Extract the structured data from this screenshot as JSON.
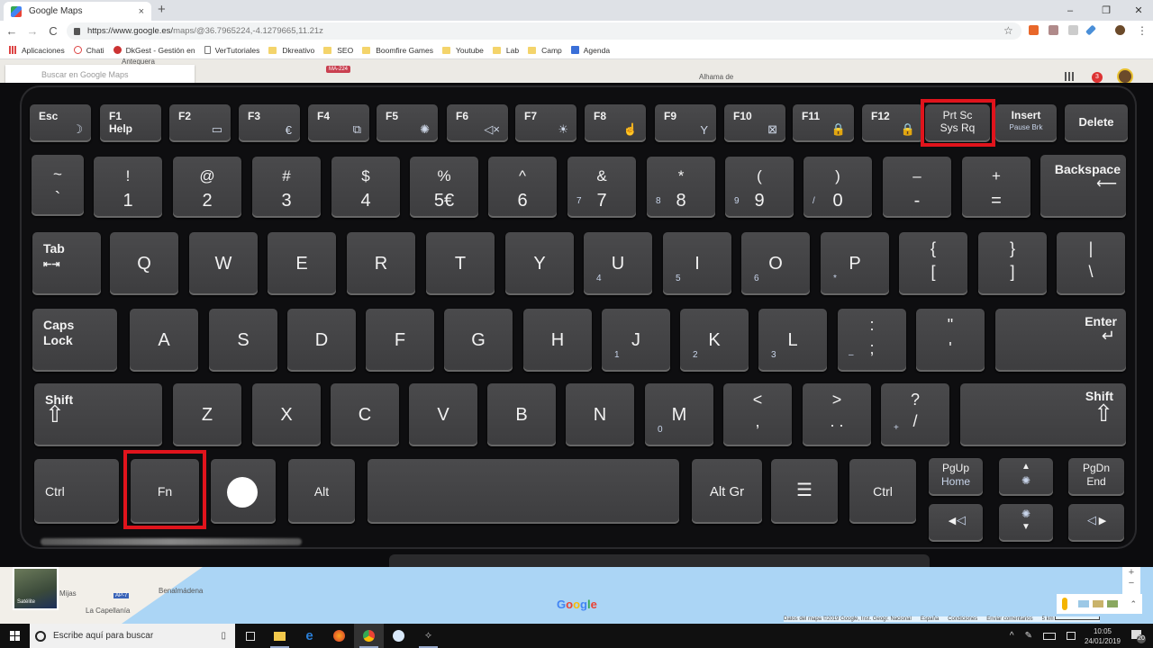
{
  "browser": {
    "tab_title": "Google Maps",
    "tab_close": "×",
    "new_tab": "+",
    "window_controls": {
      "minimize": "–",
      "restore": "❐",
      "close": "✕"
    },
    "nav": {
      "back": "←",
      "forward": "→",
      "reload": "C"
    },
    "url_host": "https://www.google.es/",
    "url_path": "maps/@36.7965224,-4.1279665,11.21z",
    "bookmark_star": "☆",
    "menu": "⋮",
    "bookmarks": [
      {
        "label": "Aplicaciones",
        "icon": "apps-grid-icon"
      },
      {
        "label": "Chati",
        "icon": "chat-icon"
      },
      {
        "label": "DkGest - Gestión en",
        "icon": "dkgest-icon"
      },
      {
        "label": "VerTutoriales",
        "icon": "page-icon"
      },
      {
        "label": "Dkreativo",
        "icon": "folder-icon"
      },
      {
        "label": "SEO",
        "icon": "folder-icon"
      },
      {
        "label": "Boomfire Games",
        "icon": "folder-icon"
      },
      {
        "label": "Youtube",
        "icon": "folder-icon"
      },
      {
        "label": "Lab",
        "icon": "folder-icon"
      },
      {
        "label": "Camp",
        "icon": "folder-icon"
      },
      {
        "label": "Agenda",
        "icon": "calendar-icon"
      }
    ]
  },
  "map": {
    "search_placeholder": "Buscar en Google Maps",
    "road_badge": "MA-224",
    "labels": {
      "top_town": "Antequera",
      "alhama": "Alhama de",
      "mijas": "Mijas",
      "benalmadena": "Benalmádena",
      "capellania": "La Capellanía",
      "ap7": "AP-7"
    },
    "satellite_label": "Satélite",
    "google_logo": "Google",
    "notification_count": "3",
    "footer": [
      "Datos del mapa ©2019 Google, Inst. Geogr. Nacional",
      "España",
      "Condiciones",
      "Enviar comentarios",
      "5 km"
    ],
    "zoom_plus": "+",
    "zoom_minus": "−",
    "expand": "⌃"
  },
  "keyboard": {
    "highlight_color": "#e0141c",
    "fn_row": [
      {
        "label": "Esc",
        "sub": "",
        "icon": "☽"
      },
      {
        "label": "F1",
        "sub": "Help",
        "icon": ""
      },
      {
        "label": "F2",
        "sub": "",
        "icon": "▭"
      },
      {
        "label": "F3",
        "sub": "",
        "icon": "€"
      },
      {
        "label": "F4",
        "sub": "",
        "icon": "⧉"
      },
      {
        "label": "F5",
        "sub": "",
        "icon": "✺"
      },
      {
        "label": "F6",
        "sub": "",
        "icon": "◁×"
      },
      {
        "label": "F7",
        "sub": "",
        "icon": "☀"
      },
      {
        "label": "F8",
        "sub": "",
        "icon": "☝"
      },
      {
        "label": "F9",
        "sub": "",
        "icon": "Y"
      },
      {
        "label": "F10",
        "sub": "",
        "icon": "⊠"
      },
      {
        "label": "F11",
        "sub": "",
        "icon": "🔒"
      },
      {
        "label": "F12",
        "sub": "",
        "icon": "🔒"
      }
    ],
    "prtsc": {
      "line1": "Prt Sc",
      "line2": "Sys Rq"
    },
    "insert": {
      "line1": "Insert",
      "line2": "Pause Brk"
    },
    "delete": "Delete",
    "num_row": [
      {
        "top": "~",
        "bot": "`",
        "num": ""
      },
      {
        "top": "!",
        "bot": "1",
        "num": ""
      },
      {
        "top": "@",
        "bot": "2",
        "num": ""
      },
      {
        "top": "#",
        "bot": "3",
        "num": ""
      },
      {
        "top": "$",
        "bot": "4",
        "num": ""
      },
      {
        "top": "%",
        "bot": "5€",
        "num": ""
      },
      {
        "top": "^",
        "bot": "6",
        "num": ""
      },
      {
        "top": "&",
        "bot": "7",
        "num": "7"
      },
      {
        "top": "*",
        "bot": "8",
        "num": "8"
      },
      {
        "top": "(",
        "bot": "9",
        "num": "9"
      },
      {
        "top": ")",
        "bot": "0",
        "num": "/"
      },
      {
        "top": "–",
        "bot": "-",
        "num": ""
      },
      {
        "top": "+",
        "bot": "=",
        "num": ""
      }
    ],
    "backspace": {
      "label": "Backspace",
      "arrow": "⟵"
    },
    "tab": {
      "label": "Tab",
      "arrow": "⇤⇥"
    },
    "qwerty_row": [
      {
        "main": "Q",
        "num": ""
      },
      {
        "main": "W",
        "num": ""
      },
      {
        "main": "E",
        "num": ""
      },
      {
        "main": "R",
        "num": ""
      },
      {
        "main": "T",
        "num": ""
      },
      {
        "main": "Y",
        "num": ""
      },
      {
        "main": "U",
        "num": "4"
      },
      {
        "main": "I",
        "num": "5"
      },
      {
        "main": "O",
        "num": "6"
      },
      {
        "main": "P",
        "num": "*"
      }
    ],
    "bracket_keys": [
      {
        "top": "{",
        "bot": "["
      },
      {
        "top": "}",
        "bot": "]"
      },
      {
        "top": "|",
        "bot": "\\"
      }
    ],
    "caps": {
      "line1": "Caps",
      "line2": "Lock"
    },
    "home_row": [
      {
        "main": "A",
        "num": ""
      },
      {
        "main": "S",
        "num": ""
      },
      {
        "main": "D",
        "num": ""
      },
      {
        "main": "F",
        "num": ""
      },
      {
        "main": "G",
        "num": ""
      },
      {
        "main": "H",
        "num": ""
      },
      {
        "main": "J",
        "num": "1"
      },
      {
        "main": "K",
        "num": "2"
      },
      {
        "main": "L",
        "num": "3"
      }
    ],
    "punct_home": [
      {
        "top": ":",
        "bot": ";",
        "num": "–"
      },
      {
        "top": "\"",
        "bot": "'",
        "num": ""
      }
    ],
    "enter": {
      "label": "Enter",
      "arrow": "↵"
    },
    "shift_left": {
      "label": "Shift",
      "arrow": "⇧"
    },
    "bottom_letters": [
      {
        "main": "Z",
        "num": ""
      },
      {
        "main": "X",
        "num": ""
      },
      {
        "main": "C",
        "num": ""
      },
      {
        "main": "V",
        "num": ""
      },
      {
        "main": "B",
        "num": ""
      },
      {
        "main": "N",
        "num": ""
      },
      {
        "main": "M",
        "num": "0"
      }
    ],
    "punct_bottom": [
      {
        "top": "<",
        "bot": ",",
        "num": ""
      },
      {
        "top": ">",
        "bot": ". .",
        "num": ""
      },
      {
        "top": "?",
        "bot": "/",
        "num": "+"
      }
    ],
    "shift_right": {
      "label": "Shift",
      "arrow": "⇧"
    },
    "ctrl_left": "Ctrl",
    "fn": "Fn",
    "windows_key_icon": "●",
    "alt": "Alt",
    "space": "",
    "altgr": "Alt Gr",
    "menu_key_icon": "☰",
    "ctrl_right": "Ctrl",
    "pgup": {
      "line1": "PgUp",
      "line2": "Home"
    },
    "pgdn": {
      "line1": "PgDn",
      "line2": "End"
    },
    "up": {
      "arrow": "▲",
      "icon": "✺"
    },
    "down": {
      "arrow": "▼",
      "icon": "✺"
    },
    "left": {
      "arrow": "◀",
      "icon": "◁"
    },
    "right": {
      "arrow": "▶",
      "icon": "◁"
    }
  },
  "taskbar": {
    "search_placeholder": "Escribe aquí para buscar",
    "mic": "🎙",
    "apps": [
      "task-view",
      "file-explorer",
      "edge",
      "firefox",
      "chrome",
      "outlook",
      "app"
    ],
    "tray_chevron": "^",
    "time": "10:05",
    "date": "24/01/2019",
    "notifications": "20"
  }
}
